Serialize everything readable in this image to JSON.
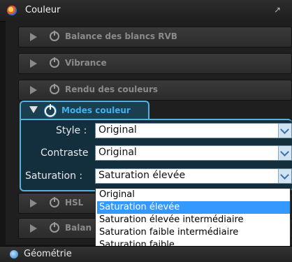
{
  "window": {
    "title": "Couleur"
  },
  "sections": [
    {
      "label": "Balance des blancs RVB"
    },
    {
      "label": "Vibrance"
    },
    {
      "label": "Rendu des couleurs"
    },
    {
      "label": "HSL"
    },
    {
      "label": "Balan"
    }
  ],
  "modes": {
    "header": "Modes couleur",
    "style": {
      "label": "Style :",
      "value": "Original"
    },
    "contraste": {
      "label": "Contraste",
      "value": "Original"
    },
    "saturation": {
      "label": "Saturation :",
      "value": "Saturation élevée"
    }
  },
  "dropdown": {
    "options": [
      "Original",
      "Saturation élevée",
      "Saturation élevée intermédiaire",
      "Saturation faible intermédiaire",
      "Saturation faible"
    ],
    "selected_index": 1
  },
  "bottom_tab": {
    "label": "Géométrie"
  }
}
